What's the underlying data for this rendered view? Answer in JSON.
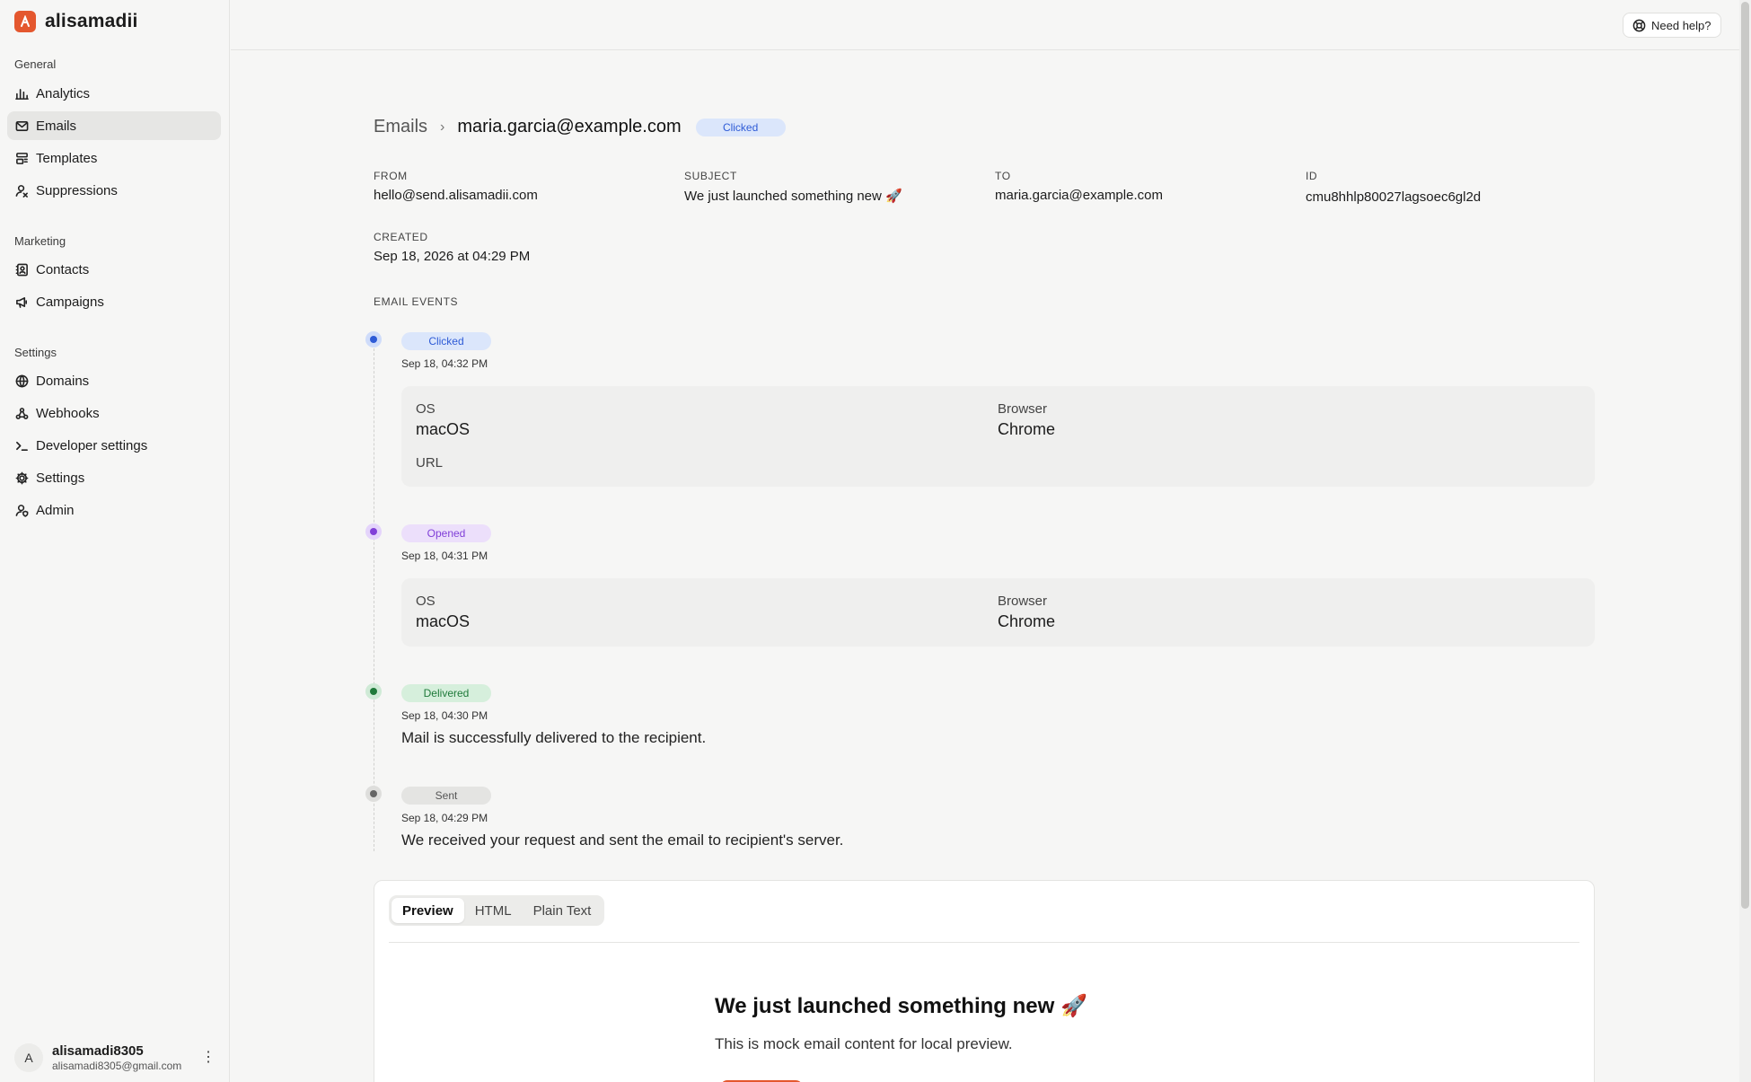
{
  "app": {
    "name": "alisamadii"
  },
  "sidebar": {
    "groups": [
      {
        "title": "General",
        "items": [
          {
            "label": "Analytics",
            "icon": "bar-chart-icon"
          },
          {
            "label": "Emails",
            "icon": "mail-icon",
            "active": true
          },
          {
            "label": "Templates",
            "icon": "template-icon"
          },
          {
            "label": "Suppressions",
            "icon": "user-block-icon"
          }
        ]
      },
      {
        "title": "Marketing",
        "items": [
          {
            "label": "Contacts",
            "icon": "contacts-icon"
          },
          {
            "label": "Campaigns",
            "icon": "megaphone-icon"
          }
        ]
      },
      {
        "title": "Settings",
        "items": [
          {
            "label": "Domains",
            "icon": "globe-icon"
          },
          {
            "label": "Webhooks",
            "icon": "webhook-icon"
          },
          {
            "label": "Developer settings",
            "icon": "terminal-icon"
          },
          {
            "label": "Settings",
            "icon": "gear-icon"
          },
          {
            "label": "Admin",
            "icon": "user-shield-icon"
          }
        ]
      }
    ]
  },
  "user": {
    "initial": "A",
    "name": "alisamadi8305",
    "email": "alisamadi8305@gmail.com"
  },
  "topbar": {
    "help_label": "Need help?"
  },
  "breadcrumb": {
    "parent": "Emails",
    "current": "maria.garcia@example.com",
    "status": "Clicked"
  },
  "email": {
    "from_label": "FROM",
    "from": "hello@send.alisamadii.com",
    "subject_label": "SUBJECT",
    "subject": "We just launched something new 🚀",
    "to_label": "TO",
    "to": "maria.garcia@example.com",
    "id_label": "ID",
    "id": "cmu8hhlp80027lagsoec6gl2d",
    "created_label": "CREATED",
    "created": "Sep 18, 2026 at 04:29 PM"
  },
  "events": {
    "title": "EMAIL EVENTS",
    "clicked": {
      "status": "Clicked",
      "time": "Sep 18, 04:32 PM",
      "os_label": "OS",
      "os": "macOS",
      "browser_label": "Browser",
      "browser": "Chrome",
      "url_label": "URL"
    },
    "opened": {
      "status": "Opened",
      "time": "Sep 18, 04:31 PM",
      "os_label": "OS",
      "os": "macOS",
      "browser_label": "Browser",
      "browser": "Chrome"
    },
    "delivered": {
      "status": "Delivered",
      "time": "Sep 18, 04:30 PM",
      "message": "Mail is successfully delivered to the recipient."
    },
    "sent": {
      "status": "Sent",
      "time": "Sep 18, 04:29 PM",
      "message": "We received your request and sent the email to recipient's server."
    }
  },
  "preview": {
    "tabs": [
      "Preview",
      "HTML",
      "Plain Text"
    ],
    "active_tab": "Preview",
    "title": "We just launched something new 🚀",
    "body": "This is mock email content for local preview."
  },
  "colors": {
    "brand": "#e4572e",
    "clicked": "#2e5bd6",
    "opened": "#8140d8",
    "delivered": "#1f7a3a"
  }
}
